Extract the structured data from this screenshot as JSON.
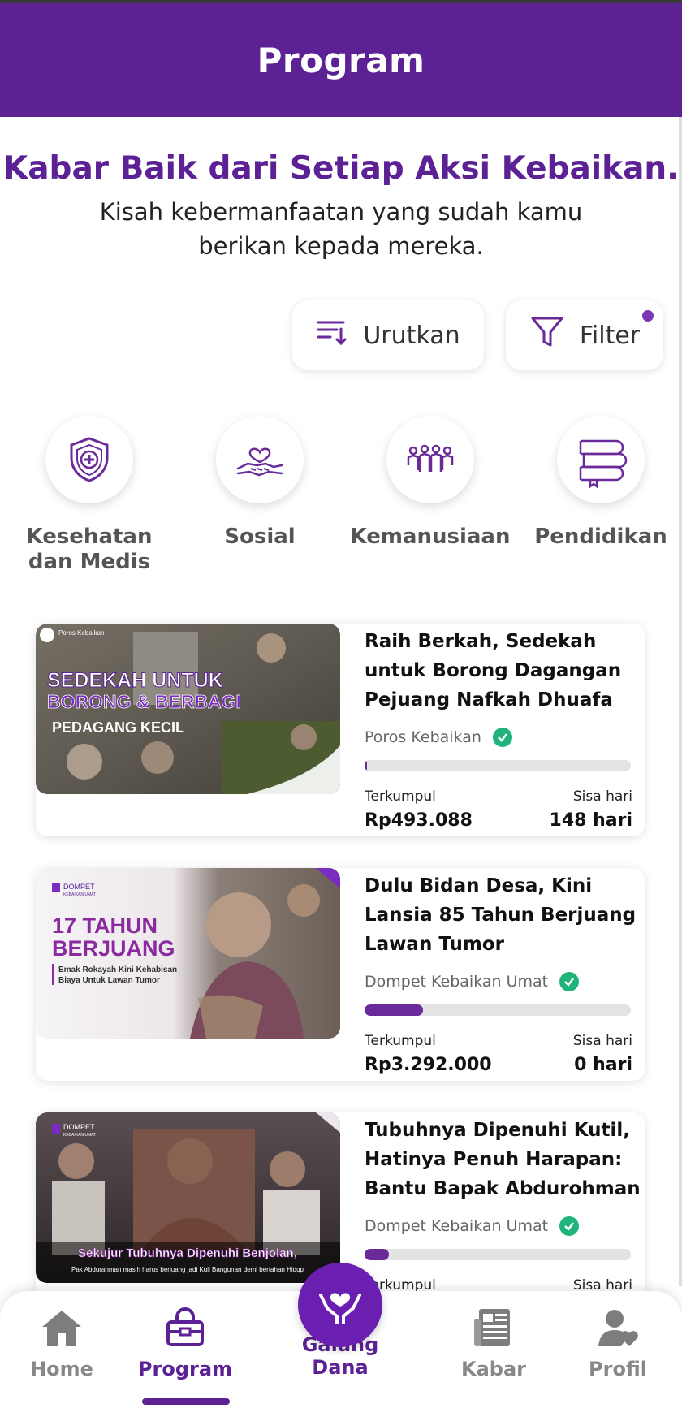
{
  "header": {
    "title": "Program"
  },
  "intro": {
    "headline": "Kabar Baik dari Setiap Aksi Kebaikan.",
    "subtitle": "Kisah kebermanfaatan yang sudah kamu berikan kepada mereka."
  },
  "toolbar": {
    "sort_label": "Urutkan",
    "filter_label": "Filter",
    "filter_active": true
  },
  "categories": [
    {
      "label": "Kesehatan dan Medis",
      "icon": "medical-shield-icon"
    },
    {
      "label": "Sosial",
      "icon": "heart-hands-icon"
    },
    {
      "label": "Kemanusiaan",
      "icon": "people-icon"
    },
    {
      "label": "Pendidikan",
      "icon": "books-icon"
    }
  ],
  "campaigns": [
    {
      "title": "Raih Berkah, Sedekah untuk Borong Dagangan Pejuang Nafkah Dhuafa",
      "organizer": "Poros Kebaikan",
      "progress": 0.01,
      "collected_label": "Terkumpul",
      "collected": "Rp493.088",
      "remaining_label": "Sisa hari",
      "remaining": "148 hari",
      "image": {
        "logo": "Poros Kebaikan",
        "line1": "SEDEKAH UNTUK",
        "line2": "BORONG & BERBAGI",
        "line3": "PEDAGANG KECIL"
      }
    },
    {
      "title": "Dulu Bidan Desa, Kini Lansia 85 Tahun Berjuang Lawan Tumor",
      "organizer": "Dompet Kebaikan Umat",
      "progress": 0.22,
      "collected_label": "Terkumpul",
      "collected": "Rp3.292.000",
      "remaining_label": "Sisa hari",
      "remaining": "0 hari",
      "image": {
        "logo": "DOMPET",
        "logo_sub": "KEBAIKAN UMAT",
        "line1": "17 TAHUN",
        "line2": "BERJUANG",
        "line3": "Emak Rokayah Kini Kehabisan",
        "line4": "Biaya Untuk Lawan Tumor"
      }
    },
    {
      "title": "Tubuhnya Dipenuhi Kutil, Hatinya Penuh Harapan: Bantu Bapak Abdurohman",
      "organizer": "Dompet Kebaikan Umat",
      "progress": 0.09,
      "collected_label": "Terkumpul",
      "collected": "",
      "remaining_label": "Sisa hari",
      "remaining": "",
      "image": {
        "logo": "DOMPET",
        "logo_sub": "KEBAIKAN UMAT",
        "line1": "Sekujur Tubuhnya Dipenuhi Benjolan,",
        "line2": "Pak Abdurahman masih harus berjuang jadi Kuli Bangunan demi bertahan Hidup"
      }
    }
  ],
  "bottom_nav": {
    "items": [
      {
        "label": "Home",
        "icon": "home-icon"
      },
      {
        "label": "Program",
        "icon": "program-icon"
      },
      {
        "label": "Galang Dana",
        "icon": "hands-heart-icon"
      },
      {
        "label": "Kabar",
        "icon": "newspaper-icon"
      },
      {
        "label": "Profil",
        "icon": "profile-icon"
      }
    ],
    "active": "Program"
  },
  "colors": {
    "brand": "#5b2195",
    "verified": "#1fb57a",
    "inactive": "#888888"
  }
}
